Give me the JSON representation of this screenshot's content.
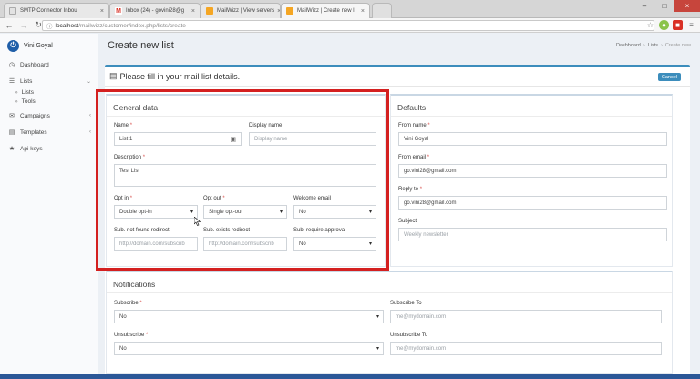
{
  "browser": {
    "tabs": [
      {
        "title": "SMTP Connector Inbou",
        "color": "#e2e2e2"
      },
      {
        "title": "Inbox (24) - govini28@g",
        "color": "#d93025"
      },
      {
        "title": "MailWizz | View servers",
        "color": "#f5a623"
      },
      {
        "title": "MailWizz | Create new li",
        "color": "#f5a623"
      }
    ],
    "url_host": "localhost",
    "url_path": "/mailwizz/customer/index.php/lists/create"
  },
  "sidebar": {
    "user_name": "Vini Goyal",
    "logo_glyph": "⏻",
    "items": [
      {
        "label": "Dashboard",
        "icon": "dashboard-icon"
      },
      {
        "label": "Lists",
        "icon": "list-icon"
      },
      {
        "label": "Campaigns",
        "icon": "envelope-icon"
      },
      {
        "label": "Templates",
        "icon": "template-icon"
      },
      {
        "label": "Api keys",
        "icon": "star-icon"
      }
    ],
    "sub_items": [
      {
        "label": "Lists"
      },
      {
        "label": "Tools"
      }
    ]
  },
  "page": {
    "title": "Create new list",
    "breadcrumb": [
      "Dashboard",
      "Lists",
      "Create new"
    ],
    "panel_title": "Please fill in your mail list details.",
    "cancel_label": "Cancel"
  },
  "general": {
    "title": "General data",
    "name_label": "Name",
    "name_value": "List 1",
    "display_name_label": "Display name",
    "display_name_placeholder": "Display name",
    "description_label": "Description",
    "description_value": "Test List",
    "opt_in_label": "Opt in",
    "opt_in_value": "Double opt-in",
    "opt_out_label": "Opt out",
    "opt_out_value": "Single opt-out",
    "welcome_label": "Welcome email",
    "welcome_value": "No",
    "sub_not_found_label": "Sub. not found redirect",
    "sub_not_found_placeholder": "http://domain.com/subscrib",
    "sub_exists_label": "Sub. exists redirect",
    "sub_exists_placeholder": "http://domain.com/subscrib",
    "sub_approval_label": "Sub. require approval",
    "sub_approval_value": "No"
  },
  "defaults": {
    "title": "Defaults",
    "from_name_label": "From name",
    "from_name_value": "Vini Goyal",
    "from_email_label": "From email",
    "from_email_value": "go.vini28@gmail.com",
    "reply_to_label": "Reply to",
    "reply_to_value": "go.vini28@gmail.com",
    "subject_label": "Subject",
    "subject_placeholder": "Weekly newsletter"
  },
  "notifications": {
    "title": "Notifications",
    "subscribe_label": "Subscribe",
    "subscribe_value": "No",
    "subscribe_to_label": "Subscribe To",
    "subscribe_to_placeholder": "me@mydomain.com",
    "unsubscribe_label": "Unsubscribe",
    "unsubscribe_value": "No",
    "unsubscribe_to_label": "Unsubscribe To",
    "unsubscribe_to_placeholder": "me@mydomain.com"
  },
  "colors": {
    "accent": "#3c8dbc",
    "highlight": "#d42020"
  }
}
